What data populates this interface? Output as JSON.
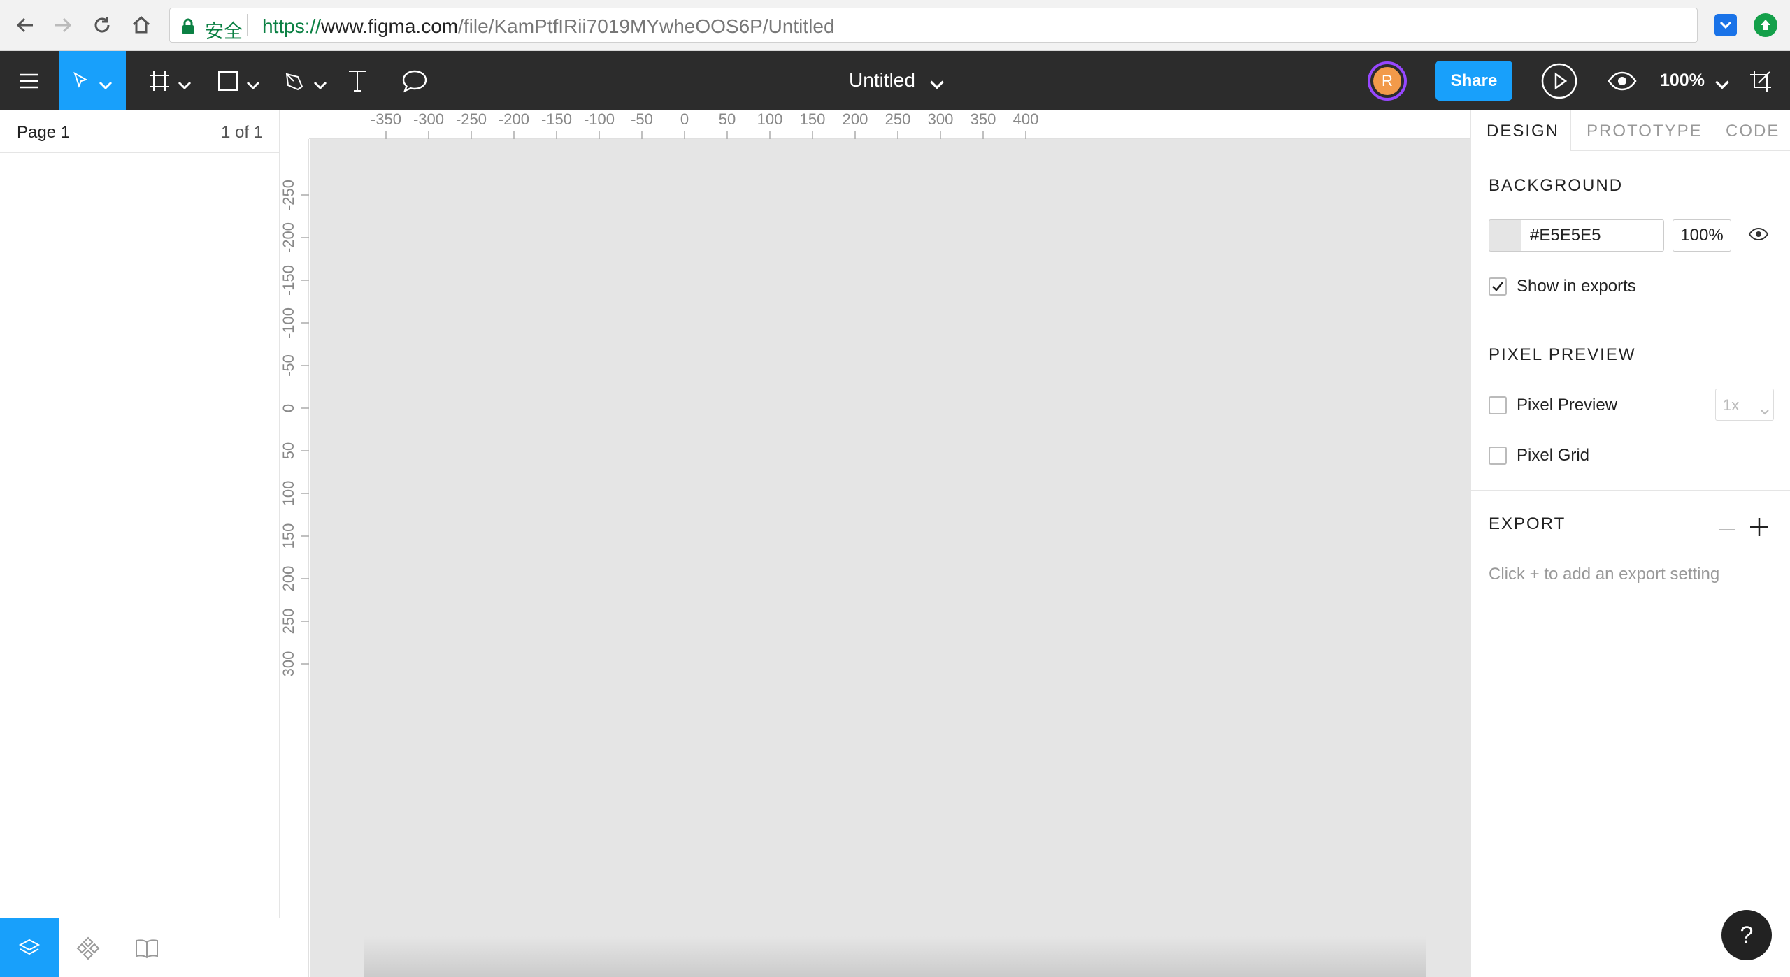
{
  "browser": {
    "secure_label": "安全",
    "url_scheme": "https://",
    "url_host": "www.figma.com",
    "url_path": "/file/KamPtfIRii7019MYwheOOS6P/Untitled"
  },
  "toolbar": {
    "file_title": "Untitled",
    "avatar_initial": "R",
    "share_label": "Share",
    "zoom_level": "100%"
  },
  "left_panel": {
    "page_name": "Page 1",
    "page_count": "1 of 1"
  },
  "rulers": {
    "top": [
      "-350",
      "-300",
      "-250",
      "-200",
      "-150",
      "-100",
      "-50",
      "0",
      "50",
      "100",
      "150",
      "200",
      "250",
      "300",
      "350",
      "400"
    ],
    "left": [
      "-250",
      "-200",
      "-150",
      "-100",
      "-50",
      "0",
      "50",
      "100",
      "150",
      "200",
      "250",
      "300"
    ]
  },
  "right_panel": {
    "tabs": [
      {
        "label": "DESIGN"
      },
      {
        "label": "PROTOTYPE"
      },
      {
        "label": "CODE"
      }
    ],
    "background": {
      "title": "BACKGROUND",
      "hex": "#E5E5E5",
      "opacity": "100%",
      "show_in_exports_label": "Show in exports"
    },
    "pixel_preview": {
      "title": "PIXEL PREVIEW",
      "preview_label": "Pixel Preview",
      "grid_label": "Pixel Grid",
      "scale": "1x"
    },
    "export": {
      "title": "EXPORT",
      "hint": "Click + to add an export setting"
    }
  },
  "help": {
    "label": "?"
  },
  "colors": {
    "accent": "#18a0fb",
    "toolbar_bg": "#2c2c2c",
    "canvas_bg": "#e5e5e5",
    "avatar_bg": "#f29a4a",
    "avatar_ring": "#9747ff"
  }
}
